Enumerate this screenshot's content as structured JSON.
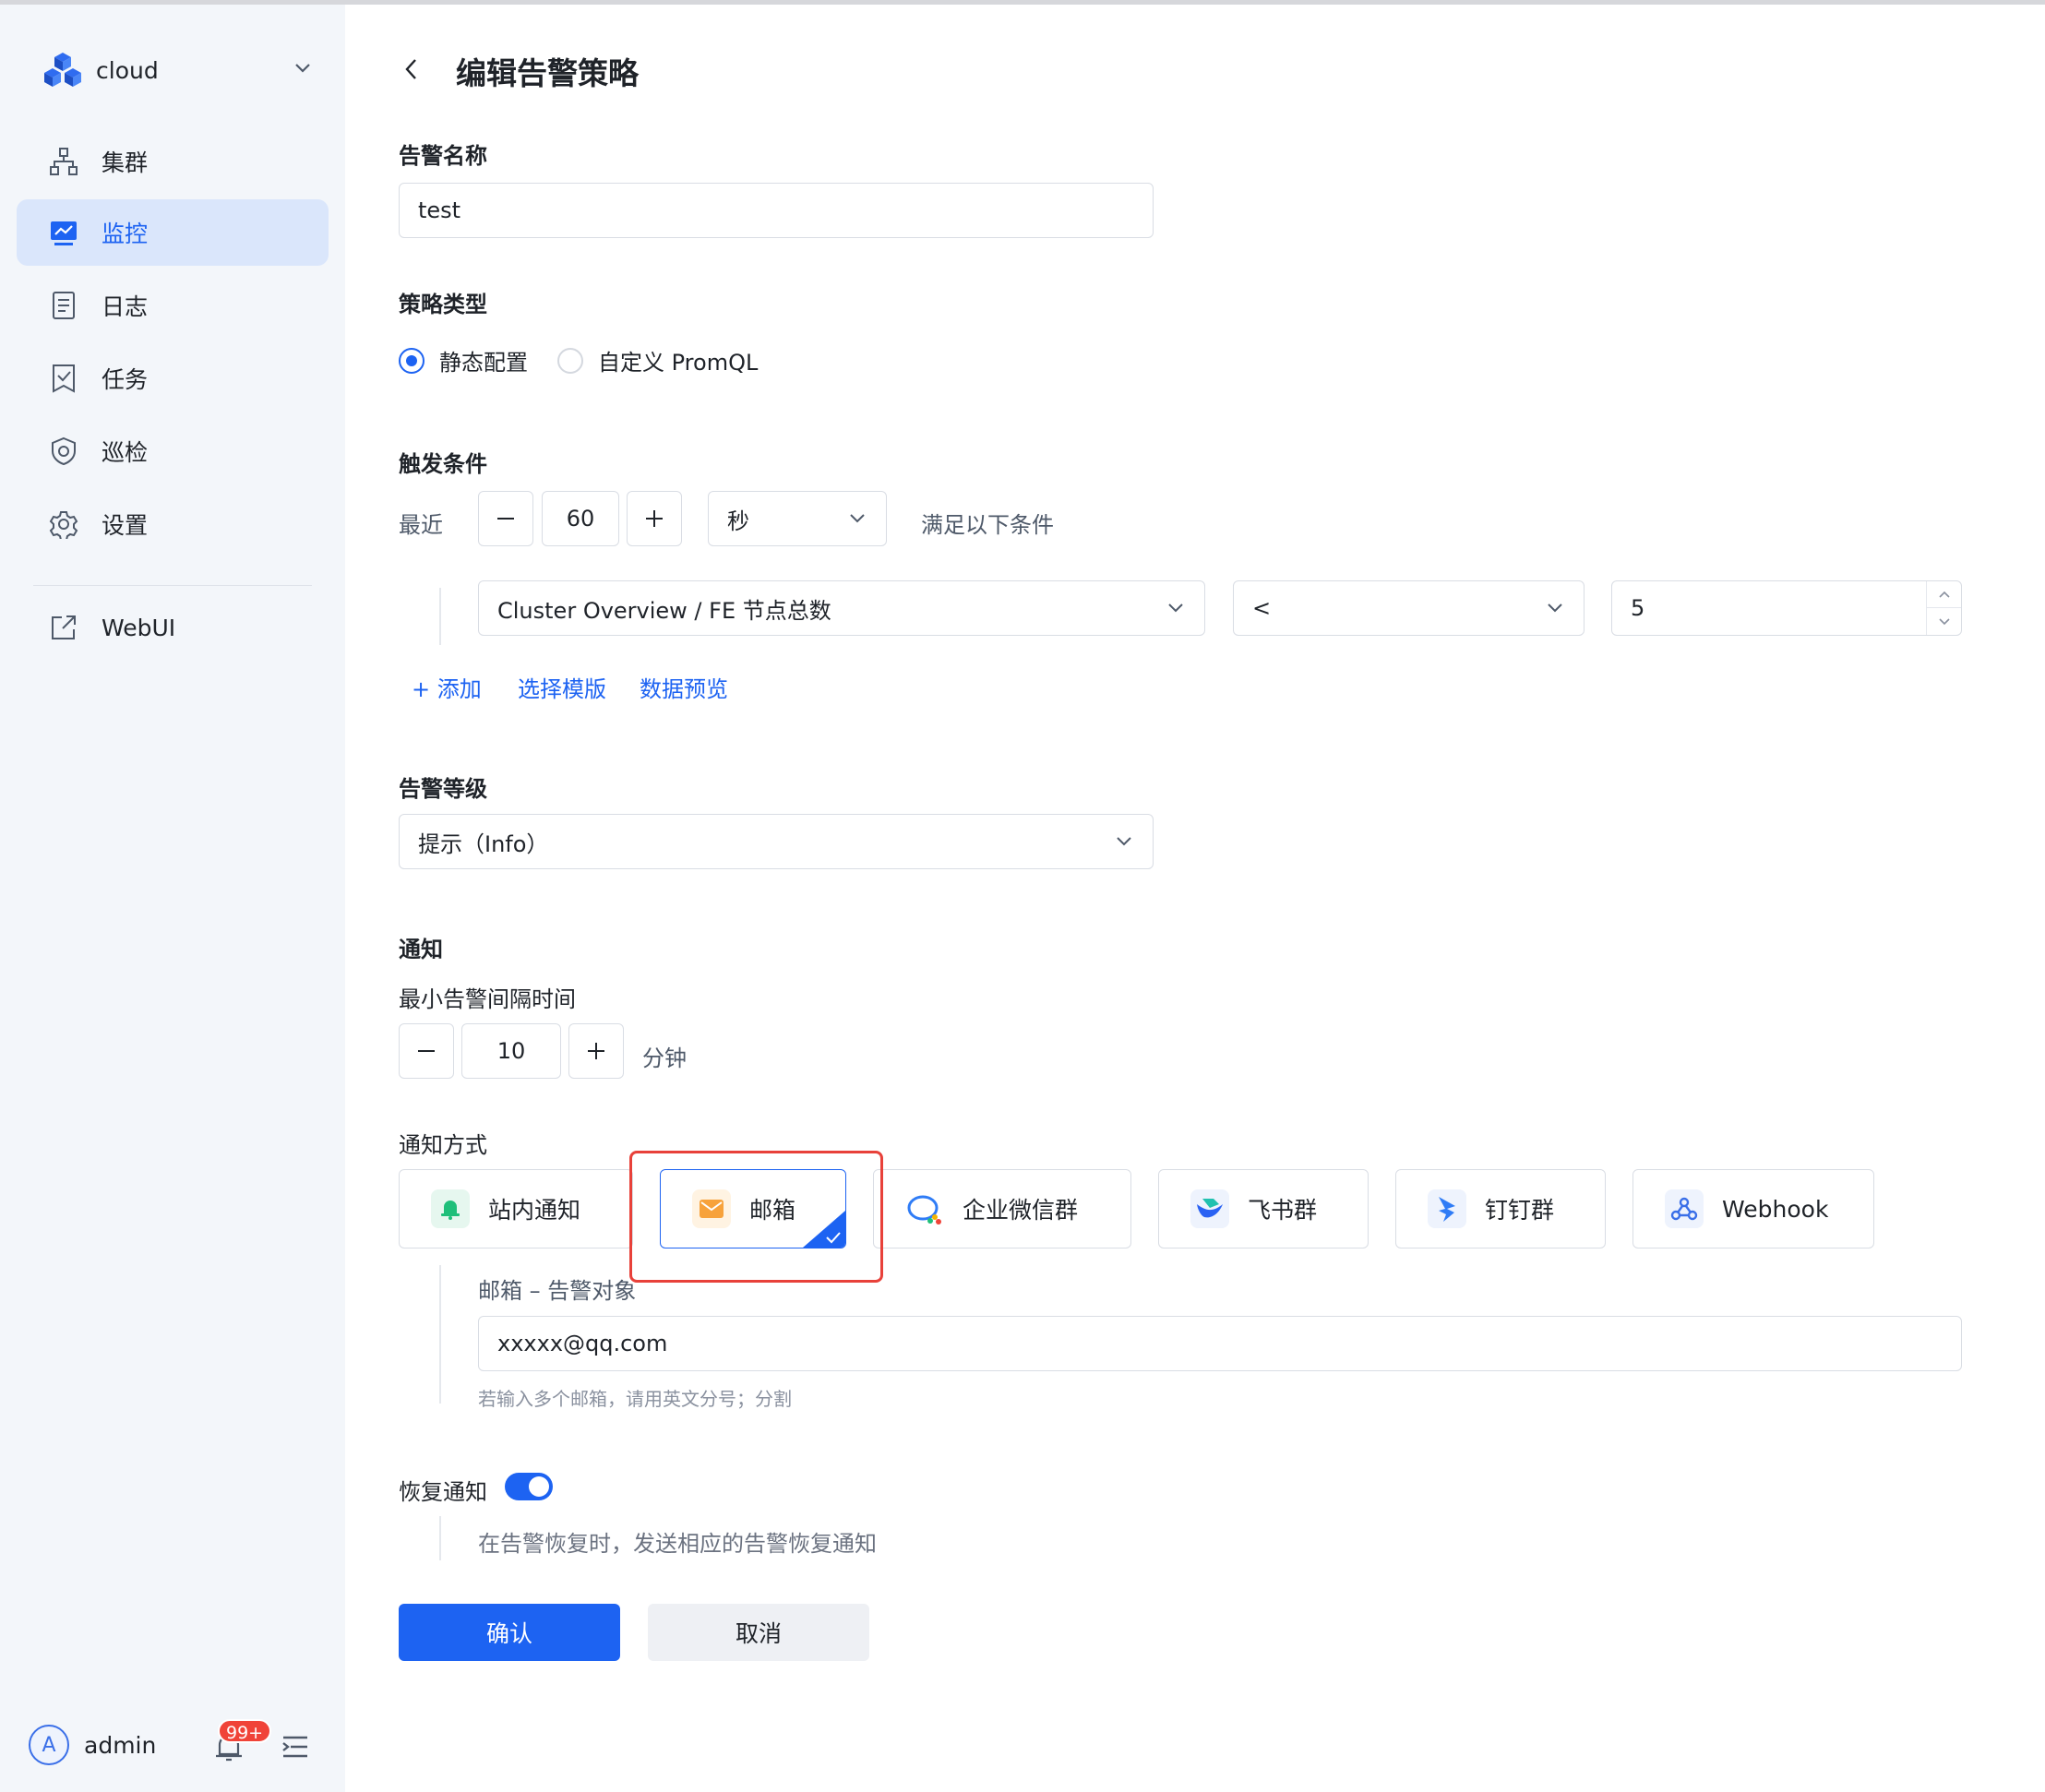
{
  "sidebar": {
    "brand": "cloud",
    "items": [
      {
        "label": "集群",
        "icon": "cluster-icon"
      },
      {
        "label": "监控",
        "icon": "monitor-icon",
        "active": true
      },
      {
        "label": "日志",
        "icon": "log-icon"
      },
      {
        "label": "任务",
        "icon": "task-icon"
      },
      {
        "label": "巡检",
        "icon": "inspect-shield-icon"
      },
      {
        "label": "设置",
        "icon": "gear-icon"
      },
      {
        "label": "WebUI",
        "icon": "external-link-icon"
      }
    ],
    "user": {
      "initial": "A",
      "name": "admin"
    },
    "notifications_badge": "99+"
  },
  "page": {
    "title": "编辑告警策略"
  },
  "form": {
    "name": {
      "label": "告警名称",
      "value": "test"
    },
    "policy_type": {
      "label": "策略类型",
      "options": [
        "静态配置",
        "自定义 PromQL"
      ],
      "selected": "静态配置"
    },
    "trigger": {
      "label": "触发条件",
      "recent_label": "最近",
      "duration_value": "60",
      "duration_unit": "秒",
      "suffix": "满足以下条件",
      "metric": "Cluster Overview / FE 节点总数",
      "operator": "<",
      "threshold": "5",
      "add_link": "添加",
      "template_link": "选择模版",
      "preview_link": "数据预览"
    },
    "level": {
      "label": "告警等级",
      "value": "提示（Info）"
    },
    "notify": {
      "label": "通知",
      "interval_label": "最小告警间隔时间",
      "interval_value": "10",
      "interval_unit": "分钟",
      "methods_label": "通知方式",
      "methods": [
        {
          "label": "站内通知",
          "icon": "bell-icon",
          "color": "#1fbf7a"
        },
        {
          "label": "邮箱",
          "icon": "mail-icon",
          "color": "#f7a23b",
          "selected": true
        },
        {
          "label": "企业微信群",
          "icon": "wecom-icon",
          "color": "#2f7cf6"
        },
        {
          "label": "飞书群",
          "icon": "feishu-icon",
          "color": "#2a62f3"
        },
        {
          "label": "钉钉群",
          "icon": "dingtalk-icon",
          "color": "#2f7cf6"
        },
        {
          "label": "Webhook",
          "icon": "webhook-icon",
          "color": "#3a6fe8"
        }
      ],
      "email_target_label": "邮箱 – 告警对象",
      "email_value": "xxxxx@qq.com",
      "email_hint": "若输入多个邮箱，请用英文分号；分割"
    },
    "recovery": {
      "label": "恢复通知",
      "enabled": true,
      "description": "在告警恢复时，发送相应的告警恢复通知"
    },
    "confirm_label": "确认",
    "cancel_label": "取消"
  },
  "colors": {
    "accent": "#1d63f2",
    "highlight_box": "#e8413a",
    "sidebar_bg": "#f3f6fa"
  }
}
